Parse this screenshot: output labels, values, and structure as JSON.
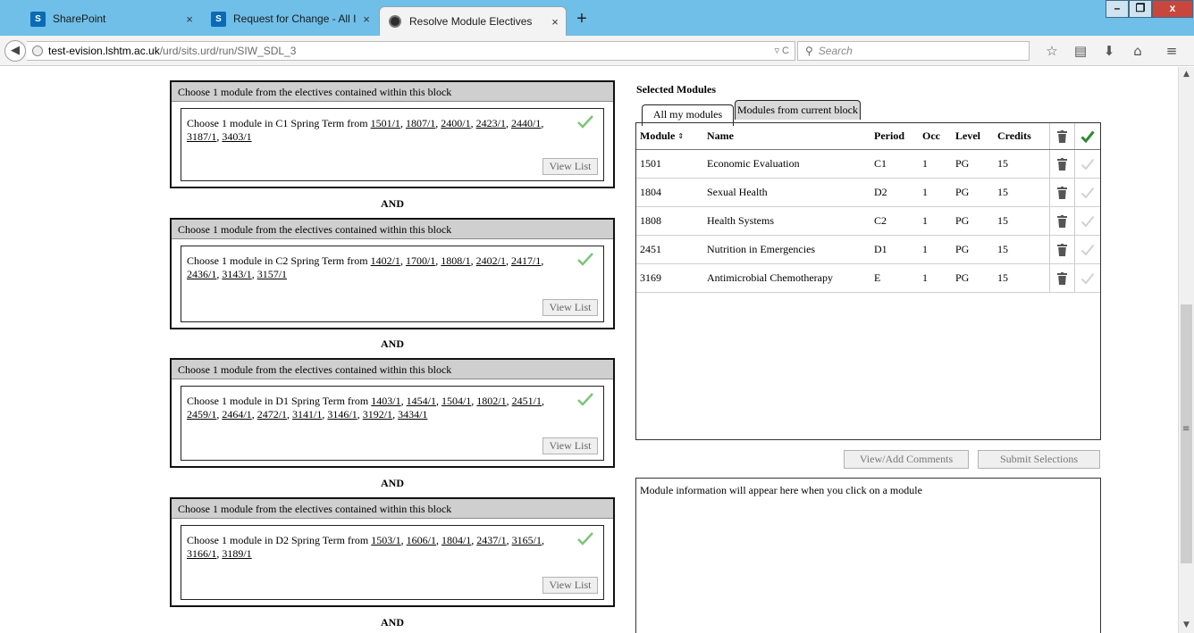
{
  "browser": {
    "tabs": [
      {
        "title": "SharePoint",
        "icon": "sharepoint-icon"
      },
      {
        "title": "Request for Change - All It...",
        "icon": "sharepoint-icon"
      },
      {
        "title": "Resolve Module Electives",
        "icon": "firefox-page-icon"
      }
    ],
    "close_glyph": "×",
    "new_tab_glyph": "+",
    "window_buttons": {
      "minimize": "–",
      "maximize": "❐",
      "close": "x"
    },
    "url": {
      "host": "test-evision.lshtm.ac.uk",
      "path": "/urd/sits.urd/run/SIW_SDL_3",
      "prefix": ""
    },
    "url_actions_glyph": "▿ C",
    "search_placeholder": "Search",
    "toolbar_icons": [
      "star-icon",
      "reading-list-icon",
      "download-icon",
      "home-icon",
      "menu-icon"
    ]
  },
  "blocks": [
    {
      "header": "Choose 1 module from the electives contained within this block",
      "rule_prefix": "Choose 1 module in C1 Spring Term from ",
      "links": [
        "1501/1",
        "1807/1",
        "2400/1",
        "2423/1",
        "2440/1",
        "3187/1",
        "3403/1"
      ],
      "button": "View List"
    },
    {
      "header": "Choose 1 module from the electives contained within this block",
      "rule_prefix": "Choose 1 module in C2 Spring Term from ",
      "links": [
        "1402/1",
        "1700/1",
        "1808/1",
        "2402/1",
        "2417/1",
        "2436/1",
        "3143/1",
        "3157/1"
      ],
      "button": "View List"
    },
    {
      "header": "Choose 1 module from the electives contained within this block",
      "rule_prefix": "Choose 1 module in D1 Spring Term from ",
      "links": [
        "1403/1",
        "1454/1",
        "1504/1",
        "1802/1",
        "2451/1",
        "2459/1",
        "2464/1",
        "2472/1",
        "3141/1",
        "3146/1",
        "3192/1",
        "3434/1"
      ],
      "button": "View List"
    },
    {
      "header": "Choose 1 module from the electives contained within this block",
      "rule_prefix": "Choose 1 module in D2 Spring Term from ",
      "links": [
        "1503/1",
        "1606/1",
        "1804/1",
        "2437/1",
        "3165/1",
        "3166/1",
        "3189/1"
      ],
      "button": "View List"
    }
  ],
  "and_label": "AND",
  "selected": {
    "title": "Selected Modules",
    "tabs": [
      "All my modules",
      "Modules from current block"
    ],
    "columns": {
      "module": "Module",
      "name": "Name",
      "period": "Period",
      "occ": "Occ",
      "level": "Level",
      "credits": "Credits"
    },
    "sort_glyph": "⇕",
    "rows": [
      {
        "module": "1501",
        "name": "Economic Evaluation",
        "period": "C1",
        "occ": "1",
        "level": "PG",
        "credits": "15"
      },
      {
        "module": "1804",
        "name": "Sexual Health",
        "period": "D2",
        "occ": "1",
        "level": "PG",
        "credits": "15"
      },
      {
        "module": "1808",
        "name": "Health Systems",
        "period": "C2",
        "occ": "1",
        "level": "PG",
        "credits": "15"
      },
      {
        "module": "2451",
        "name": "Nutrition in Emergencies",
        "period": "D1",
        "occ": "1",
        "level": "PG",
        "credits": "15"
      },
      {
        "module": "3169",
        "name": "Antimicrobial Chemotherapy",
        "period": "E",
        "occ": "1",
        "level": "PG",
        "credits": "15"
      }
    ],
    "buttons": {
      "comments": "View/Add Comments",
      "submit": "Submit Selections"
    },
    "info_text": "Module information will appear here when you click on a module"
  },
  "colors": {
    "titlebar": "#6fbfe8",
    "check_green": "#3a9a3a",
    "check_light": "#cfcfcf"
  }
}
